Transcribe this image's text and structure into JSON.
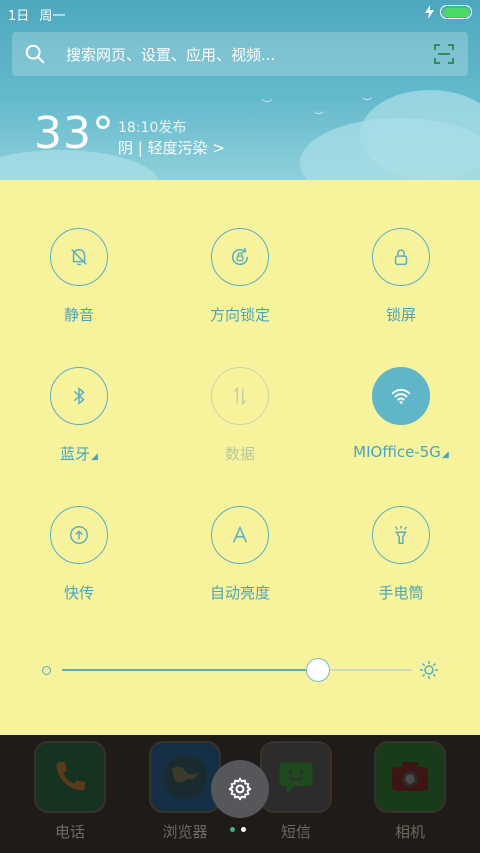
{
  "status": {
    "date": "1日",
    "weekday": "周一",
    "battery_level": 1.0
  },
  "search": {
    "placeholder": "搜索网页、设置、应用、视频..."
  },
  "weather": {
    "temperature": "33°",
    "published": "18:10发布",
    "description": "阴 | 轻度污染 >"
  },
  "quick_settings": {
    "tiles": [
      {
        "id": "silent",
        "label": "静音",
        "icon": "bell-off-icon",
        "state": "off"
      },
      {
        "id": "rotation-lock",
        "label": "方向锁定",
        "icon": "rotation-lock-icon",
        "state": "off"
      },
      {
        "id": "lock-screen",
        "label": "锁屏",
        "icon": "lock-icon",
        "state": "off"
      },
      {
        "id": "bluetooth",
        "label": "蓝牙",
        "icon": "bluetooth-icon",
        "state": "off",
        "expandable": true
      },
      {
        "id": "data",
        "label": "数据",
        "icon": "data-arrows-icon",
        "state": "disabled"
      },
      {
        "id": "wifi",
        "label": "MIOffice-5G",
        "icon": "wifi-icon",
        "state": "on",
        "expandable": true
      },
      {
        "id": "transfer",
        "label": "快传",
        "icon": "upload-icon",
        "state": "off"
      },
      {
        "id": "auto-brightness",
        "label": "自动亮度",
        "icon": "auto-brightness-icon",
        "state": "off"
      },
      {
        "id": "flashlight",
        "label": "手电筒",
        "icon": "flashlight-icon",
        "state": "off"
      }
    ],
    "brightness": 0.73
  },
  "dock": {
    "apps": [
      {
        "label": "电话",
        "icon": "phone-icon"
      },
      {
        "label": "浏览器",
        "icon": "browser-globe-icon"
      },
      {
        "label": "短信",
        "icon": "message-icon"
      },
      {
        "label": "相机",
        "icon": "camera-icon"
      }
    ],
    "settings_button": "gear-icon"
  },
  "colors": {
    "panel_bg": "#f7f39d",
    "accent": "#59aec3",
    "header": "#5bb3c8"
  }
}
